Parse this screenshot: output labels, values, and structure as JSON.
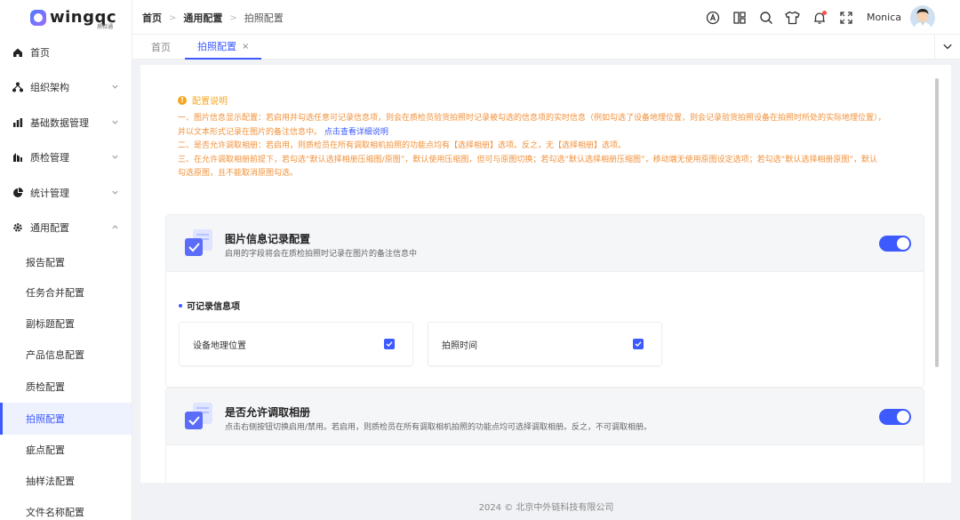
{
  "app": {
    "logo_text": "wingqc",
    "logo_sub": "质检通",
    "username": "Monica"
  },
  "colors": {
    "accent": "#3d5afe",
    "warning": "#f5a623"
  },
  "sidebar": {
    "items": [
      {
        "label": "首页",
        "icon": "home-icon"
      },
      {
        "label": "组织架构",
        "icon": "org-icon"
      },
      {
        "label": "基础数据管理",
        "icon": "data-icon"
      },
      {
        "label": "质检管理",
        "icon": "inspection-icon"
      },
      {
        "label": "统计管理",
        "icon": "pie-icon"
      },
      {
        "label": "通用配置",
        "icon": "gear-icon"
      }
    ],
    "sub_items": [
      "报告配置",
      "任务合并配置",
      "副标题配置",
      "产品信息配置",
      "质检配置",
      "拍照配置",
      "疵点配置",
      "抽样法配置",
      "文件名称配置"
    ]
  },
  "breadcrumb": [
    "首页",
    "通用配置",
    "拍照配置"
  ],
  "tabs": [
    {
      "label": "首页"
    },
    {
      "label": "拍照配置",
      "close": "×"
    }
  ],
  "notice": {
    "title": "配置说明",
    "line1": "一、图片信息显示配置：若启用并勾选任意可记录信息项，则会在质检员验货拍照时记录被勾选的信息项的实时信息（例如勾选了设备地理位置，则会记录验货拍照设备在拍照时所处的实际地理位置），",
    "line2": "并以文本形式记录在图片的备注信息中。",
    "link": "点击查看详细说明",
    "line3": "二、是否允许调取相册：若启用，则质检员在所有调取相机拍照的功能点均有【选择相册】选项。反之，无【选择相册】选项。",
    "line4": "三、在允许调取相册前提下，若勾选“默认选择相册压缩图/原图”，默认使用压缩图，但可与原图切换；若勾选“默认选择相册压缩图”，移动端无使用原图设定选项；若勾选“默认选择相册原图”，默认",
    "line5": "勾选原图，且不能取消原图勾选。"
  },
  "cards": {
    "image_info": {
      "title": "图片信息记录配置",
      "desc": "启用的字段将会在质检拍照时记录在图片的备注信息中",
      "enabled": true,
      "section_label": "可记录信息项",
      "options": [
        {
          "label": "设备地理位置",
          "checked": true
        },
        {
          "label": "拍照时间",
          "checked": true
        }
      ]
    },
    "album": {
      "title": "是否允许调取相册",
      "desc": "点击右侧按钮切换启用/禁用。若启用，则质检员在所有调取相机拍照的功能点均可选择调取相册。反之，不可调取相册。",
      "enabled": true
    }
  },
  "footer": "2024 © 北京中外链科技有限公司"
}
